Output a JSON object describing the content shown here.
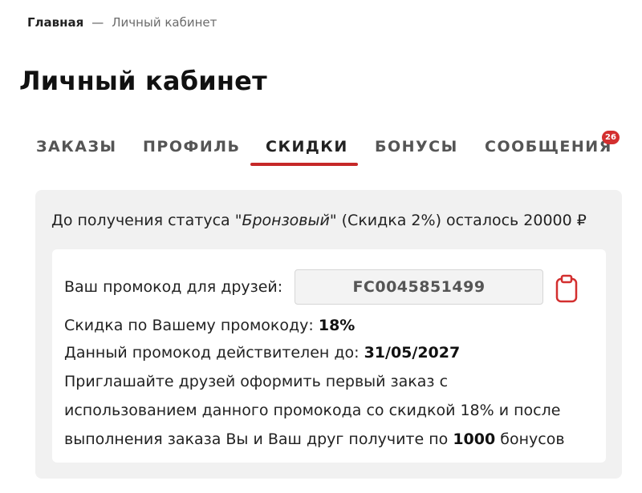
{
  "breadcrumb": {
    "home": "Главная",
    "separator": "—",
    "current": "Личный кабинет"
  },
  "page": {
    "title": "Личный кабинет"
  },
  "tabs": [
    {
      "label": "ЗАКАЗЫ"
    },
    {
      "label": "ПРОФИЛЬ"
    },
    {
      "label": "СКИДКИ"
    },
    {
      "label": "БОНУСЫ"
    },
    {
      "label": "СООБЩЕНИЯ",
      "badge": "26"
    }
  ],
  "status": {
    "prefix": "До получения статуса \"",
    "level": "Бронзовый",
    "suffix": "\" (Скидка 2%) осталось 20000 ₽"
  },
  "promo": {
    "label": "Ваш промокод для друзей:",
    "code": "FC0045851499",
    "discount_label": "Скидка по Вашему промокоду:",
    "discount_value": "18%",
    "valid_label": "Данный промокод действителен до:",
    "valid_date": "31/05/2027",
    "invite_line1": "Приглашайте друзей оформить первый заказ с",
    "invite_line2": "использованием данного промокода со скидкой 18% и после",
    "invite_line3_prefix": "выполнения заказа Вы и Ваш друг получите по",
    "invite_bonus": "1000",
    "invite_line3_suffix": "бонусов"
  },
  "colors": {
    "accent": "#c62828",
    "badge": "#d32f2f",
    "card_bg": "#f1f1f1",
    "icon": "#d32f2f"
  },
  "icons": {
    "copy": "clipboard-icon"
  }
}
